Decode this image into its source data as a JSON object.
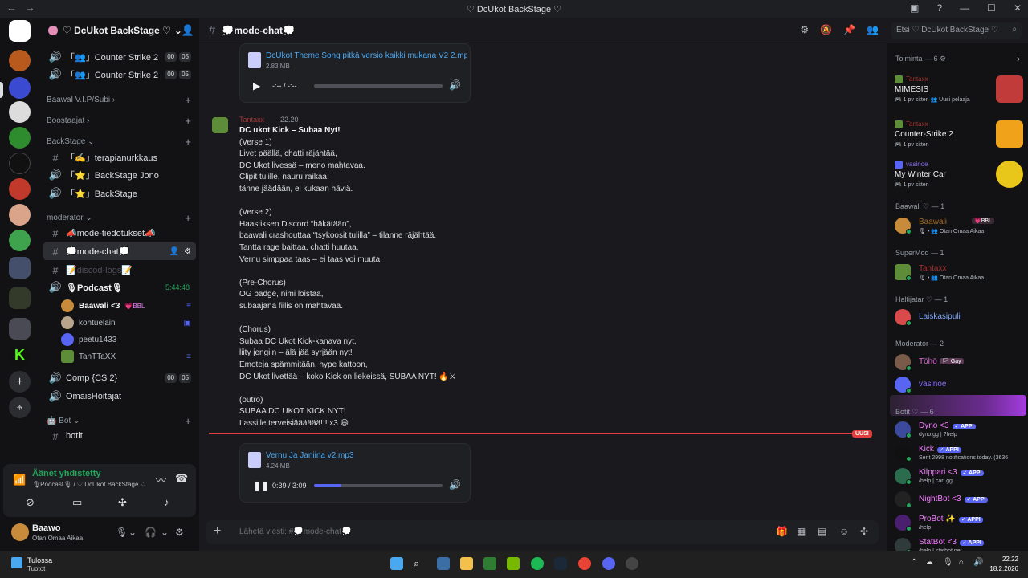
{
  "window": {
    "title": "♡ DcUkot BackStage ♡"
  },
  "server": {
    "name": "♡ DcUkot BackStage ♡"
  },
  "channels": {
    "items": [
      {
        "label": "「👥」Counter Strike 2",
        "kind": "voice",
        "left": "00",
        "right": "05"
      },
      {
        "label": "「👥」Counter Strike 2",
        "kind": "voice",
        "left": "00",
        "right": "05"
      }
    ],
    "cat_vip": "Baawal V.I.P/Subi",
    "cat_boost": "Boostaajat",
    "cat_backstage": "BackStage",
    "terapia": "「✍️」terapianurkkaus",
    "jono": "「⭐」BackStage Jono",
    "backstage": "「⭐」BackStage",
    "cat_mod": "moderator",
    "mode_tiedotukset": "📣mode-tiedotukset📣",
    "mode_chat": "💭mode-chat💭",
    "discord_logs": "📝discod-logs📝",
    "podcast": "🎙Podcast🎙",
    "podcast_time": "5:44:48",
    "voice_users": [
      "Baawali <3",
      "kohtuelain",
      "peetu1433",
      "TanTTaXX"
    ],
    "bbl": "💗BBL",
    "comp": "Comp {CS 2}",
    "comp_left": "00",
    "comp_right": "05",
    "omais": "OmaisHoitajat",
    "cat_bot": "🤖 Bot",
    "botit": "botit"
  },
  "voice": {
    "status": "Äänet yhdistetty",
    "sub": "🎙Podcast🎙 / ♡ DcUkot BackStage ♡"
  },
  "user": {
    "name": "Baawo",
    "status": "Otan Omaa Aikaa"
  },
  "chat": {
    "channel": "💭mode-chat💭",
    "attach1": {
      "name": "DcUkot Theme Song pitkä versio kaikki mukana V2 2.mp3",
      "size": "2.83 MB",
      "time": "-:-- / -:--",
      "fill": 0
    },
    "author": "Tantaxx",
    "time": "22.20",
    "lines": [
      "DC ukot Kick – Subaa Nyt!",
      "(Verse 1)",
      "Livet päällä, chatti räjähtää,",
      "DC Ukot livessä – meno mahtavaa.",
      "Clipit tulille, nauru raikaa,",
      "tänne jäädään, ei kukaan häviä.",
      "",
      "(Verse 2)",
      "Haastiksen Discord “häkätään”,",
      "baawali crashouttaa “tsykoosit tulilla” – tilanne räjähtää.",
      "Tantta rage baittaa, chatti huutaa,",
      "Vernu simppaa taas – ei taas voi muuta.",
      "",
      "(Pre-Chorus)",
      "OG badge, nimi loistaa,",
      "subaajana fiilis on mahtavaa.",
      "",
      "(Chorus)",
      "Subaa DC Ukot Kick-kanava nyt,",
      "liity jengiin – älä jää syrjään nyt!",
      "Emoteja spämmitään, hype kattoon,",
      "DC Ukot livettää – koko Kick on liekeissä, SUBAA NYT! 🔥⚔",
      "",
      "(outro)",
      "SUBAA DC UKOT KICK NYT!",
      "Lassille terveisiääääää!!! x3 😄"
    ],
    "new_label": "UUSI",
    "attach2": {
      "name": "Vernu Ja Janiina v2.mp3",
      "size": "4.24 MB",
      "time": "0:39 / 3:09",
      "fill": 0.21
    },
    "composer_placeholder": "Lähetä viesti: #💭mode-chat💭"
  },
  "search": {
    "placeholder": "Etsi ♡ DcUkot BackStage ♡"
  },
  "members": {
    "activity_header": "Toiminta — 6 ⚙",
    "activities": [
      {
        "user": "Tantaxx",
        "game": "MIMESIS",
        "meta": "🎮 1 pv sitten   👥 Uusi pelaaja",
        "color": "#c23b3b"
      },
      {
        "user": "Tantaxx",
        "game": "Counter-Strike 2",
        "meta": "🎮 1 pv sitten",
        "color": "#f0a21a"
      },
      {
        "user": "vasinoe",
        "game": "My Winter Car",
        "meta": "🎮 1 pv sitten",
        "color": "#e8c61a"
      }
    ],
    "groups": [
      {
        "title": "Baawali ♡ — 1",
        "name": "Baawali",
        "status": "🎙 • 👥 Otan Omaa Aikaa",
        "badge": "💗BBL"
      },
      {
        "title": "SuperMod — 1",
        "name": "Tantaxx",
        "status": "🎙 • 👥 Otan Omaa Aikaa"
      },
      {
        "title": "Haltijatar ♡ — 1",
        "name": "Laiskasipuli"
      },
      {
        "title": "Moderator — 2",
        "names": [
          "Töhö",
          "vasinoe"
        ],
        "gay": "🏳 Gay"
      }
    ],
    "bots_header": "Botit ♡ — 6",
    "app_label": "✓ APPI",
    "bots": [
      {
        "name": "Dyno <3",
        "status": "dyno.gg | ?help",
        "color": "#f47fff"
      },
      {
        "name": "Kick",
        "status": "Sent 2998 notifications today. (3636",
        "color": "#f47fff"
      },
      {
        "name": "Kilppari <3",
        "status": "/help | carl.gg",
        "color": "#f47fff"
      },
      {
        "name": "NightBot <3",
        "status": "",
        "color": "#f47fff"
      },
      {
        "name": "ProBot ✨",
        "status": "/help",
        "color": "#f47fff"
      },
      {
        "name": "StatBot <3",
        "status": "/help | statbot.net",
        "color": "#f47fff"
      }
    ]
  },
  "taskbar": {
    "weather": "Tulossa",
    "weather_sub": "Tuotot",
    "time": "22.22",
    "date": "18.2.2026"
  }
}
